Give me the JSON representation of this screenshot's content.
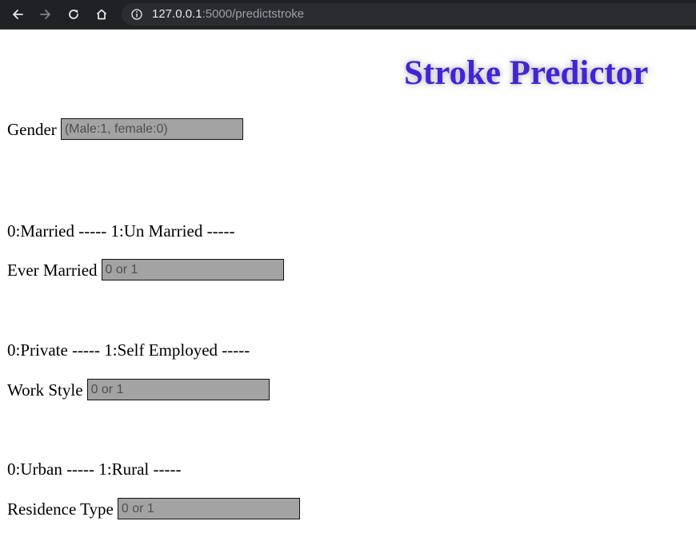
{
  "browser": {
    "url_host": "127.0.0.1",
    "url_path": ":5000/predictstroke"
  },
  "page": {
    "title": "Stroke Predictor"
  },
  "form": {
    "gender": {
      "label": "Gender",
      "placeholder": "(Male:1, female:0)"
    },
    "married_legend": "0:Married ----- 1:Un Married -----",
    "ever_married": {
      "label": "Ever Married",
      "placeholder": "0 or 1"
    },
    "work_legend": "0:Private ----- 1:Self Employed -----",
    "work_style": {
      "label": "Work Style",
      "placeholder": "0 or 1"
    },
    "residence_legend": "0:Urban ----- 1:Rural -----",
    "residence_type": {
      "label": "Residence Type",
      "placeholder": "0 or 1"
    }
  },
  "colors": {
    "title": "#4422d6",
    "input_bg": "#a3a3a3",
    "toolbar_bg": "#202124"
  }
}
